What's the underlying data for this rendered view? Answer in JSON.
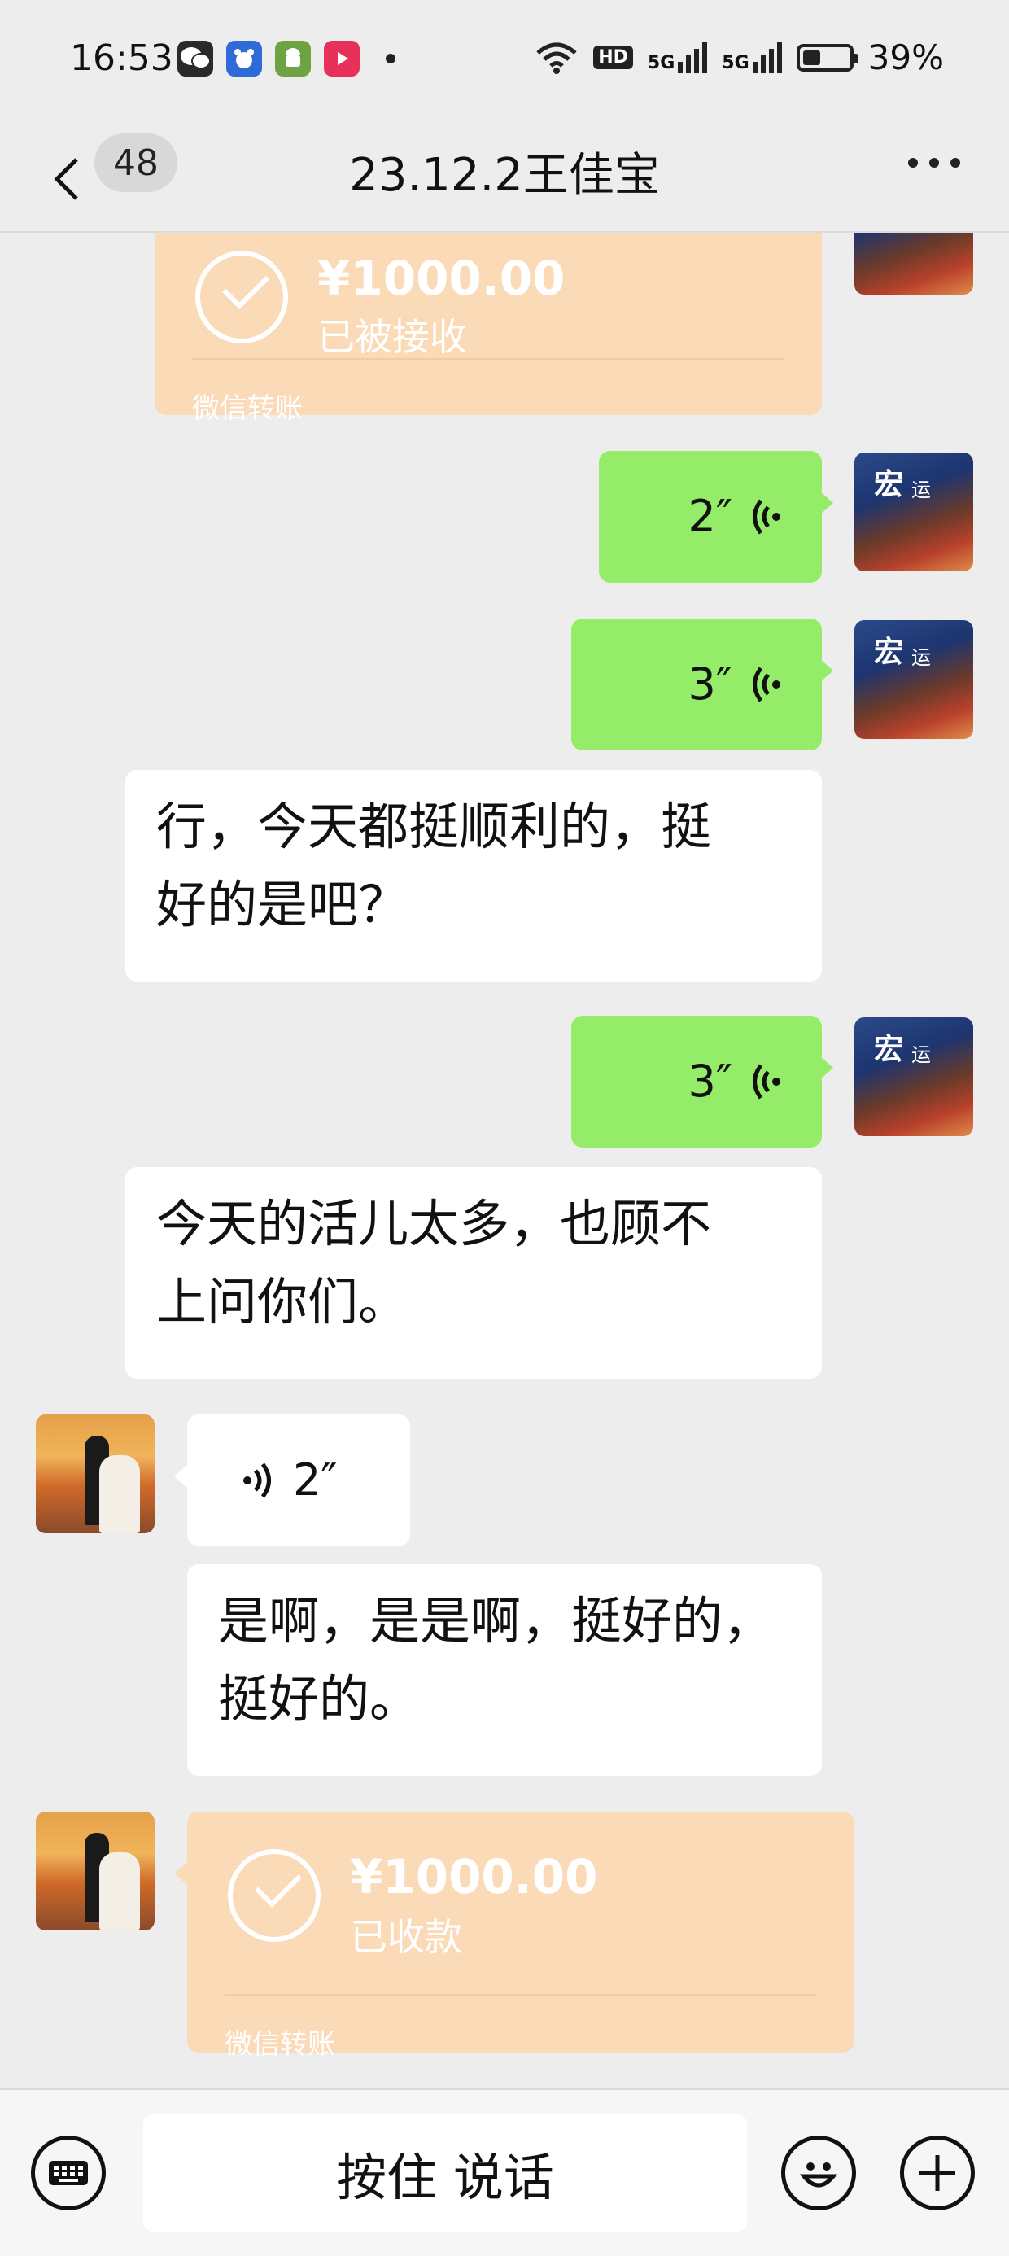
{
  "status_bar": {
    "time": "16:53",
    "battery_percent": "39%",
    "battery_level": 0.39,
    "hd_label": "HD",
    "signal_label_1": "5G",
    "signal_label_2": "5G",
    "app_icons": [
      "wechat-icon",
      "baidu-icon",
      "android-icon",
      "video-app-icon"
    ]
  },
  "header": {
    "unread_count": "48",
    "title": "23.12.2王佳宝",
    "back_icon": "chevron-left-icon",
    "more_icon": "more-dots-icon"
  },
  "messages": [
    {
      "type": "transfer",
      "side": "right",
      "amount": "¥1000.00",
      "status": "已被接收",
      "footer": "微信转账"
    },
    {
      "type": "voice",
      "side": "right",
      "duration": "2″"
    },
    {
      "type": "voice",
      "side": "right",
      "duration": "3″"
    },
    {
      "type": "text",
      "side": "right",
      "lines": [
        "行，今天都挺顺利的，挺",
        "好的是吧？"
      ]
    },
    {
      "type": "voice",
      "side": "right",
      "duration": "3″"
    },
    {
      "type": "text",
      "side": "right",
      "lines": [
        "今天的活儿太多，也顾不",
        "上问你们。"
      ]
    },
    {
      "type": "voice",
      "side": "left",
      "duration": "2″"
    },
    {
      "type": "text",
      "side": "left",
      "lines": [
        "是啊，是是啊，挺好的，",
        "挺好的。"
      ]
    },
    {
      "type": "transfer",
      "side": "left",
      "amount": "¥1000.00",
      "status": "已收款",
      "footer": "微信转账"
    }
  ],
  "input_bar": {
    "keyboard_icon": "keyboard-icon",
    "talk_label": "按住 说话",
    "emoji_icon": "emoji-icon",
    "plus_icon": "plus-icon"
  },
  "colors": {
    "background": "#ededed",
    "sent_bubble": "#95ec69",
    "received_bubble": "#ffffff",
    "transfer_bubble": "#fbdab8"
  }
}
